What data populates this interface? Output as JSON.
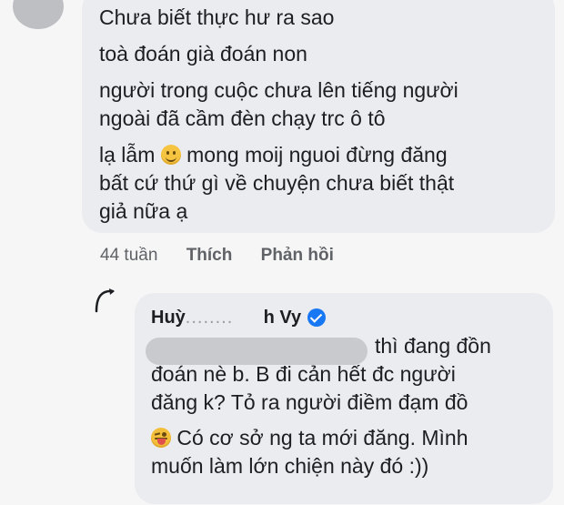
{
  "comment": {
    "lines": [
      "Chưa biết thực hư ra sao",
      "toà đoán già đoán non",
      "người trong cuộc chưa lên tiếng  người",
      "ngoài đã cầm đèn chạy trc ô tô",
      "lạ lẫm",
      "mong moij nguoi đừng đăng",
      "bất cứ thứ gì về chuyện chưa biết thật",
      "giả nữa ạ"
    ],
    "emoji_icon": "smiling-face-icon"
  },
  "meta": {
    "time": "44 tuần",
    "like_label": "Thích",
    "reply_label": "Phản hồi"
  },
  "reply": {
    "author_start": "Huỳ",
    "author_hidden": "........",
    "author_end": "h Vy",
    "verified_icon": "verified-badge-icon",
    "lines": [
      "thì đang đồn",
      "đoán nè b. B đi cản hết đc người",
      "đăng k? Tỏ ra người điềm đạm đồ",
      "Có cơ sở ng ta mới đăng. Mình",
      "muốn làm lớn chiện này đó :))"
    ],
    "emoji_icon": "winking-face-with-tongue-icon"
  }
}
